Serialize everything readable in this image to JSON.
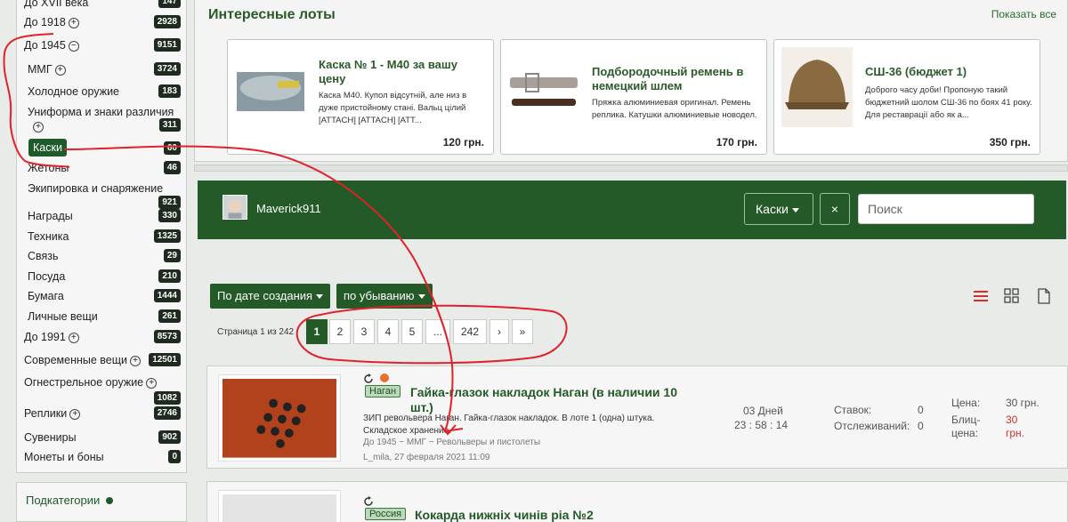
{
  "sidebar": {
    "categories": [
      {
        "label": "До XVII века",
        "count": "147"
      },
      {
        "label": "До 1918",
        "count": "2928"
      },
      {
        "label": "До 1945",
        "count": "9151"
      },
      {
        "label": "ММГ",
        "count": "3724"
      },
      {
        "label": "Холодное оружие",
        "count": "183"
      },
      {
        "label": "Униформа и знаки различия",
        "count": "311"
      },
      {
        "label": "Каски",
        "count": "60"
      },
      {
        "label": "Жетоны",
        "count": "46"
      },
      {
        "label": "Экипировка и снаряжение",
        "count": "921"
      },
      {
        "label": "Награды",
        "count": "330"
      },
      {
        "label": "Техника",
        "count": "1325"
      },
      {
        "label": "Связь",
        "count": "29"
      },
      {
        "label": "Посуда",
        "count": "210"
      },
      {
        "label": "Бумага",
        "count": "1444"
      },
      {
        "label": "Личные вещи",
        "count": "261"
      },
      {
        "label": "До 1991",
        "count": "8573"
      },
      {
        "label": "Современные вещи",
        "count": "12501"
      },
      {
        "label": "Огнестрельное оружие",
        "count": "1082"
      },
      {
        "label": "Реплики",
        "count": "2746"
      },
      {
        "label": "Сувениры",
        "count": "902"
      },
      {
        "label": "Монеты и боны",
        "count": "0"
      }
    ],
    "subcategories_label": "Подкатегории"
  },
  "lots": {
    "title": "Интересные лоты",
    "show_all": "Показать все",
    "items": [
      {
        "title": "Каска № 1 - М40 за вашу цену",
        "desc": "Каска М40. Купол відсутній, але низ в дуже пристойному стані. Вальц цілий [ATTACH] [ATTACH] [АТТ...",
        "price": "120 грн."
      },
      {
        "title": "Подбородочный ремень в немецкий шлем",
        "desc": "Пряжка алюминиевая оригинал. Ремень реплика. Катушки алюминиевые новодел.",
        "price": "170 грн."
      },
      {
        "title": "СШ-36 (бюджет 1)",
        "desc": "Доброго часу доби! Пропоную такий бюджетний шолом СШ-36 по боях 41 року. Для реставрації або як а...",
        "price": "350 грн."
      }
    ]
  },
  "header": {
    "username": "Maverick911",
    "category": "Каски",
    "clear": "×",
    "search_placeholder": "Поиск"
  },
  "sort": {
    "by": "По дате создания",
    "order": "по убыванию"
  },
  "pagination": {
    "info": "Страница 1 из 242",
    "pages": [
      "1",
      "2",
      "3",
      "4",
      "5",
      "...",
      "242",
      "›",
      "»"
    ],
    "current": "1"
  },
  "listings": [
    {
      "tag": "Наган",
      "title": "Гайка-глазок накладок Наган (в наличии 10 шт.)",
      "desc": "ЗИП револьвера Наган. Гайка-глазок накладок. В лоте 1 (одна) штука. Складское хранение.",
      "breadcrumb": "До 1945 − ММГ − Револьверы и пистолеты",
      "author": "L_mila, 27 февраля 2021 11:09",
      "time_days": "03 Дней",
      "time_clock": "23 : 58 : 14",
      "bids_label": "Ставок:",
      "bids": "0",
      "watch_label": "Отслеживаний:",
      "watch": "0",
      "price_label": "Цена:",
      "price": "30 грн.",
      "blitz_label": "Блиц-цена:",
      "blitz_label_1": "Блиц-",
      "blitz_label_2": "цена:",
      "blitz_1": "30",
      "blitz_2": "грн."
    },
    {
      "tag": "Россия",
      "title": "Кокарда нижніх чинів ріа №2"
    }
  ],
  "colors": {
    "brand_green": "#235a27",
    "annotation_red": "#e0222b"
  }
}
